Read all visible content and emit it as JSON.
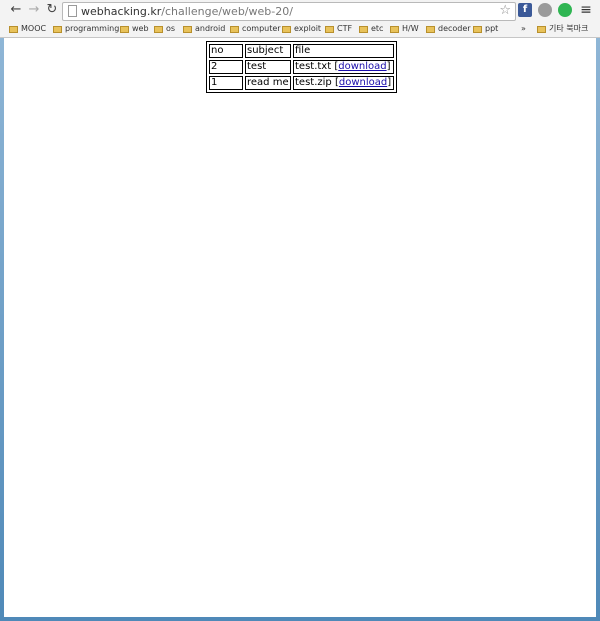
{
  "browser": {
    "url_host": "webhacking.kr",
    "url_path": "/challenge/web/web-20/",
    "nav": {
      "back": "←",
      "forward": "→",
      "reload": "↻"
    },
    "extensions": [
      {
        "label": "f",
        "color": "#3b5998",
        "name": "facebook-icon"
      },
      {
        "label": "",
        "color": "#9a9a9a",
        "name": "extension-globe-icon"
      },
      {
        "label": "",
        "color": "#2fb552",
        "name": "extension-green-icon"
      }
    ],
    "menu": "≡"
  },
  "bookmarks": {
    "items": [
      "MOOC",
      "programming",
      "web",
      "os",
      "android",
      "computer",
      "exploit",
      "CTF",
      "etc",
      "H/W",
      "decoder",
      "ppt"
    ],
    "overflow": "»",
    "other": "기타 북마크"
  },
  "table": {
    "headers": [
      "no",
      "subject",
      "file"
    ],
    "rows": [
      {
        "no": "2",
        "subject": "test",
        "filename": "test.txt",
        "link": "download"
      },
      {
        "no": "1",
        "subject": "read me",
        "filename": "test.zip",
        "link": "download"
      }
    ]
  }
}
